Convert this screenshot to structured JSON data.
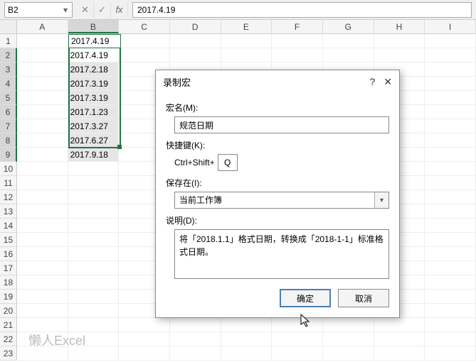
{
  "formula_bar": {
    "name_box": "B2",
    "cancel_glyph": "✕",
    "confirm_glyph": "✓",
    "fx_label": "fx",
    "formula_value": "2017.4.19"
  },
  "columns": [
    "A",
    "B",
    "C",
    "D",
    "E",
    "F",
    "G",
    "H",
    "I"
  ],
  "row_count": 23,
  "selected_col_index": 1,
  "selected_rows_from": 2,
  "selected_rows_to": 9,
  "cells": {
    "B2": "2017.4.19",
    "B3": "2017.2.18",
    "B4": "2017.3.19",
    "B5": "2017.3.19",
    "B6": "2017.1.23",
    "B7": "2017.3.27",
    "B8": "2017.6.27",
    "B9": "2017.9.18"
  },
  "dialog": {
    "title": "录制宏",
    "help_glyph": "?",
    "close_glyph": "✕",
    "macro_name_label": "宏名(M):",
    "macro_name_value": "规范日期",
    "shortcut_label": "快捷键(K):",
    "shortcut_prefix": "Ctrl+Shift+",
    "shortcut_key": "Q",
    "store_label": "保存在(I):",
    "store_value": "当前工作簿",
    "desc_label": "说明(D):",
    "desc_value": "将「2018.1.1」格式日期，转换成「2018-1-1」标准格式日期。",
    "ok_label": "确定",
    "cancel_label": "取消"
  },
  "watermark": "懒人Excel"
}
